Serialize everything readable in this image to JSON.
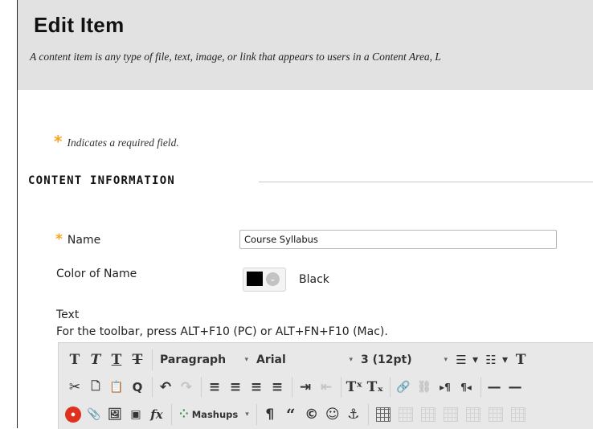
{
  "header": {
    "title": "Edit Item",
    "description": "A content item is any type of file, text, image, or link that appears to users in a Content Area, L"
  },
  "required_note": {
    "star": "*",
    "text": "Indicates a required field."
  },
  "section": {
    "title": "CONTENT INFORMATION"
  },
  "form": {
    "name": {
      "star": "*",
      "label": "Name",
      "value": "Course Syllabus"
    },
    "color": {
      "label": "Color of Name",
      "value": "Black",
      "swatch_color": "#000000",
      "chevron": "⌄"
    },
    "text": {
      "label": "Text",
      "hint": "For the toolbar, press ALT+F10 (PC) or ALT+FN+F10 (Mac)."
    }
  },
  "editor_toolbar": {
    "row1": {
      "bold": "T",
      "italic": "T",
      "underline": "T",
      "strike": "T",
      "format": "Paragraph",
      "font": "Arial",
      "size": "3 (12pt)",
      "bullet_list": "☰",
      "numbered_list": "☷",
      "text_color": "T",
      "caret": "▾"
    },
    "row2": {
      "cut": "✂",
      "copy": "🗋",
      "paste": "📋",
      "find": "Q",
      "undo": "↶",
      "redo": "↷",
      "align_left": "≡",
      "align_center": "≡",
      "align_right": "≡",
      "justify": "≡",
      "indent": "⇥",
      "outdent": "⇤",
      "superscript": "Tˣ",
      "subscript": "Tₓ",
      "link": "🔗",
      "unlink": "⛓",
      "ltr": "▸¶",
      "rtl": "¶◂",
      "hr": "—",
      "more": "—"
    },
    "row3": {
      "record": "●",
      "attach": "📎",
      "image": "🖼",
      "media": "▣",
      "math": "fx",
      "mashups": "Mashups",
      "mashups_icon": "⁘",
      "paragraph_mark": "¶",
      "quote": "“",
      "copyright": "©",
      "emoji": "☺",
      "anchor": "⚓"
    }
  }
}
